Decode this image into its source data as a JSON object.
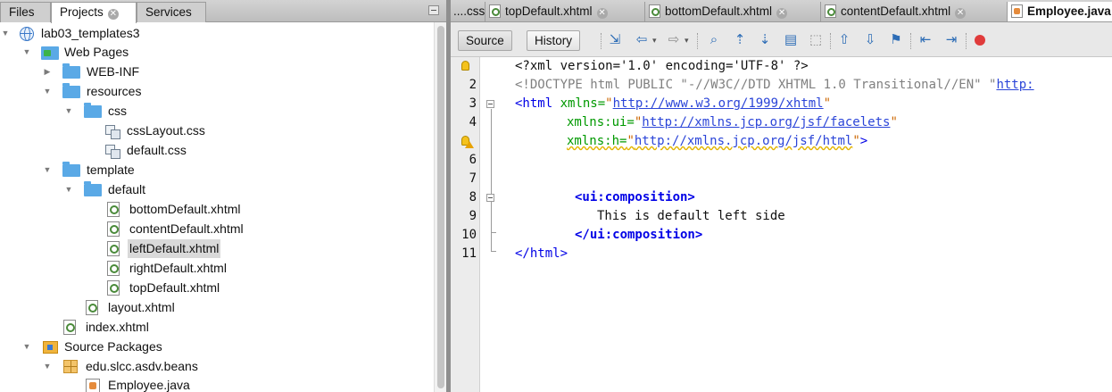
{
  "left_panel": {
    "tabs": [
      {
        "label": "Files"
      },
      {
        "label": "Projects",
        "close": "✕"
      },
      {
        "label": "Services"
      }
    ],
    "tree": [
      {
        "label": "lab03_templates3",
        "icon": "globe-icon",
        "expanded": true
      },
      {
        "label": "Web Pages",
        "icon": "web-pages-folder-icon",
        "expanded": true
      },
      {
        "label": "WEB-INF",
        "icon": "folder-icon",
        "expanded": false
      },
      {
        "label": "resources",
        "icon": "folder-icon",
        "expanded": true
      },
      {
        "label": "css",
        "icon": "folder-icon",
        "expanded": true
      },
      {
        "label": "cssLayout.css",
        "icon": "css-file-icon"
      },
      {
        "label": "default.css",
        "icon": "css-file-icon"
      },
      {
        "label": "template",
        "icon": "folder-icon",
        "expanded": true
      },
      {
        "label": "default",
        "icon": "folder-icon",
        "expanded": true
      },
      {
        "label": "bottomDefault.xhtml",
        "icon": "xhtml-file-icon"
      },
      {
        "label": "contentDefault.xhtml",
        "icon": "xhtml-file-icon"
      },
      {
        "label": "leftDefault.xhtml",
        "icon": "xhtml-file-icon",
        "selected": true
      },
      {
        "label": "rightDefault.xhtml",
        "icon": "xhtml-file-icon"
      },
      {
        "label": "topDefault.xhtml",
        "icon": "xhtml-file-icon"
      },
      {
        "label": "layout.xhtml",
        "icon": "xhtml-file-icon"
      },
      {
        "label": "index.xhtml",
        "icon": "xhtml-file-icon"
      },
      {
        "label": "Source Packages",
        "icon": "source-packages-icon",
        "expanded": true
      },
      {
        "label": "edu.slcc.asdv.beans",
        "icon": "package-icon",
        "expanded": true
      },
      {
        "label": "Employee.java",
        "icon": "java-file-icon"
      }
    ]
  },
  "editor": {
    "tabs": [
      {
        "label": "....css"
      },
      {
        "label": "topDefault.xhtml",
        "close": "✕"
      },
      {
        "label": "bottomDefault.xhtml",
        "close": "✕"
      },
      {
        "label": "contentDefault.xhtml",
        "close": "✕"
      },
      {
        "label": "Employee.java"
      }
    ],
    "toolbar": {
      "source_label": "Source",
      "history_label": "History"
    },
    "line_numbers": [
      "1",
      "2",
      "3",
      "4",
      "5",
      "6",
      "7",
      "8",
      "9",
      "10",
      "11"
    ],
    "code": {
      "l1": "<?xml version='1.0' encoding='UTF-8' ?>",
      "l2_doctype": "<!DOCTYPE html PUBLIC \"-//W3C//DTD XHTML 1.0 Transitional//EN\" \"",
      "l2_url": "http:",
      "l3_open": "<html",
      "l3_attr": "xmlns=",
      "l3_q1": "\"",
      "l3_url": "http://www.w3.org/1999/xhtml",
      "l3_q2": "\"",
      "l4_attr": "xmlns:ui=",
      "l4_q1": "\"",
      "l4_url": "http://xmlns.jcp.org/jsf/facelets",
      "l4_q2": "\"",
      "l5_attr": "xmlns:h=",
      "l5_q1": "\"",
      "l5_url": "http://xmlns.jcp.org/jsf/html",
      "l5_q2": "\"",
      "l5_close": ">",
      "l7": "<ui:composition>",
      "l8": "This is default left side",
      "l9": "</ui:composition>",
      "l10": "</html>"
    },
    "colors": {
      "tag": "#0000e6",
      "attribute": "#009900",
      "string": "#cc6600",
      "url": "#2b45d8",
      "doctype": "#808080"
    }
  }
}
